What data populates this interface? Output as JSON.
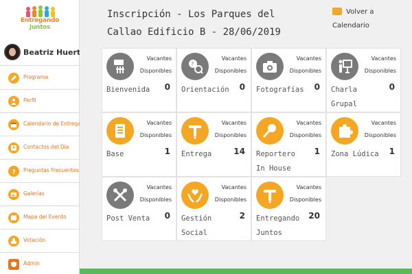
{
  "app": {
    "logo_line1": "Entregando",
    "logo_line2": "Juntos"
  },
  "user": {
    "name": "Beatriz Huerta"
  },
  "sidebar": {
    "items": [
      {
        "label": "Programa",
        "icon": "pencil-icon"
      },
      {
        "label": "Perfil",
        "icon": "user-icon"
      },
      {
        "label": "Calendario de Entregas",
        "icon": "calendar-icon"
      },
      {
        "label": "Contactos del Día",
        "icon": "contacts-icon"
      },
      {
        "label": "Preguntas Frecuentes",
        "icon": "question-icon"
      },
      {
        "label": "Galerías",
        "icon": "gallery-icon"
      },
      {
        "label": "Mapa del Evento",
        "icon": "map-icon"
      },
      {
        "label": "Votación",
        "icon": "vote-icon"
      },
      {
        "label": "Admin",
        "icon": "shield-icon"
      }
    ]
  },
  "header": {
    "title": "Inscripción - Los Parques del Callao Edificio B - 28/06/2019",
    "back_label": "Volver a Calendario"
  },
  "cards": [
    {
      "label": "Bienvenida",
      "vac": "Vacantes Disponibles",
      "count": "0",
      "icon": "welcome-sign-icon",
      "color": "#7a7a7a"
    },
    {
      "label": "Orientación",
      "vac": "Vacantes Disponibles",
      "count": "0",
      "icon": "orientation-icon",
      "color": "#7a7a7a"
    },
    {
      "label": "Fotografías",
      "vac": "Vacantes Disponibles",
      "count": "0",
      "icon": "camera-icon",
      "color": "#7a7a7a"
    },
    {
      "label": "Charla Grupal",
      "vac": "Vacantes Disponibles",
      "count": "0",
      "icon": "presentation-icon",
      "color": "#7a7a7a"
    },
    {
      "label": "Base",
      "vac": "Vacantes Disponibles",
      "count": "1",
      "icon": "document-icon",
      "color": "#f5a623"
    },
    {
      "label": "Entrega",
      "vac": "Vacantes Disponibles",
      "count": "14",
      "icon": "delivery-icon",
      "color": "#f5a623"
    },
    {
      "label": "Reportero In House",
      "vac": "Vacantes Disponibles",
      "count": "1",
      "icon": "microphone-icon",
      "color": "#f5a623"
    },
    {
      "label": "Zona Lúdica",
      "vac": "Vacantes Disponibles",
      "count": "1",
      "icon": "puzzle-icon",
      "color": "#f5a623"
    },
    {
      "label": "Post Venta",
      "vac": "Vacantes Disponibles",
      "count": "0",
      "icon": "tools-icon",
      "color": "#7a7a7a"
    },
    {
      "label": "Gestión Social",
      "vac": "Vacantes Disponibles",
      "count": "2",
      "icon": "hands-heart-icon",
      "color": "#f5a623"
    },
    {
      "label": "Entregando Juntos",
      "vac": "Vacantes Disponibles",
      "count": "20",
      "icon": "delivery-icon",
      "color": "#f5a623"
    }
  ]
}
